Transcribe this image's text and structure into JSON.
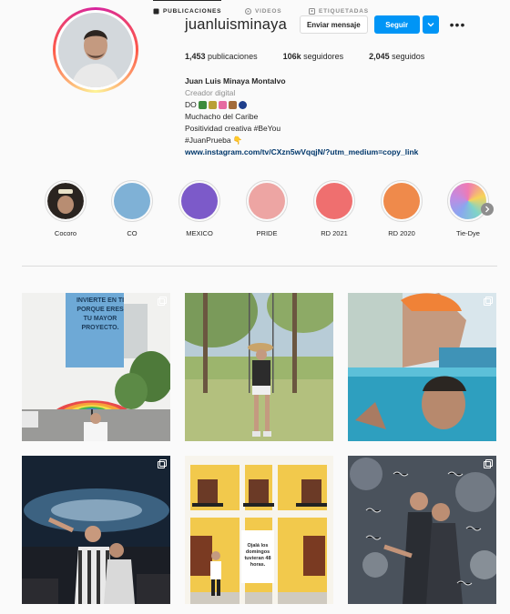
{
  "profile": {
    "username": "juanluisminaya",
    "message_button": "Enviar mensaje",
    "follow_button": "Seguir",
    "more_glyph": "•••",
    "stats": {
      "posts": "1,453",
      "posts_label": " publicaciones",
      "followers": "106k",
      "followers_label": " seguidores",
      "following": "2,045",
      "following_label": " seguidos"
    },
    "bio": {
      "full_name": "Juan Luis Minaya Montalvo",
      "category": "Creador digital",
      "line_prefix": "DO",
      "line2": "Muchacho del Caribe",
      "line3": "Positividad creativa #BeYou",
      "line4": "#JuanPrueba 👇",
      "link": "www.instagram.com/tv/CXzn5wVqqjN/?utm_medium=copy_link"
    }
  },
  "highlights": [
    {
      "label": "Cocoro",
      "color": "#2a2420"
    },
    {
      "label": "CO",
      "color": "#7fb1d6"
    },
    {
      "label": "MEXICO",
      "color": "#7c5ac9"
    },
    {
      "label": "PRIDE",
      "color": "#eda5a3"
    },
    {
      "label": "RD 2021",
      "color": "#ef6f6f"
    },
    {
      "label": "RD 2020",
      "color": "#ef8a4b"
    },
    {
      "label": "Tie-Dye",
      "color": "#c79fd6"
    }
  ],
  "tabs": {
    "posts": "PUBLICACIONES",
    "videos": "VIDEOS",
    "tagged": "ETIQUETADAS"
  },
  "posts": {
    "billboard_text": "INVIERTE EN TI PORQUE ERES TU MAYOR PROYECTO.",
    "sign_text": "Ojalá los domingos tuvieran 48 horas."
  },
  "colors": {
    "accent": "#0095f6",
    "link": "#00376b",
    "muted": "#8e8e8e"
  }
}
